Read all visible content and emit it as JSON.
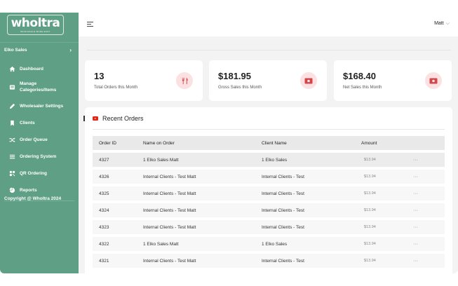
{
  "brand": {
    "name": "wholtra",
    "tagline": "WHOLESALE MADE EASY"
  },
  "sidebar": {
    "org": "Elko Sales",
    "items": [
      {
        "label": "Dashboard",
        "icon": "home-icon"
      },
      {
        "label": "Manage Categories/Items",
        "icon": "list-icon"
      },
      {
        "label": "Wholesaler Settings",
        "icon": "pencil-icon"
      },
      {
        "label": "Clients",
        "icon": "bookmark-icon"
      },
      {
        "label": "Order Queue",
        "icon": "shuffle-icon"
      },
      {
        "label": "Ordering System",
        "icon": "menu-lines-icon"
      },
      {
        "label": "QR Ordering",
        "icon": "qr-code-icon"
      },
      {
        "label": "Reports",
        "icon": "pie-chart-icon"
      }
    ],
    "copyright": "Copyright @ Wholtra 2024"
  },
  "header": {
    "user": "Matt"
  },
  "stats": [
    {
      "value": "13",
      "caption": "Total Orders this Month",
      "icon": "fork-knife-icon"
    },
    {
      "value": "$181.95",
      "caption": "Gross Sales this Month",
      "icon": "cash-icon"
    },
    {
      "value": "$168.40",
      "caption": "Net Sales this Month",
      "icon": "cash-icon"
    }
  ],
  "orders": {
    "title": "Recent Orders",
    "columns": [
      "Order ID",
      "Name on Order",
      "Client Name",
      "Amount"
    ],
    "rows": [
      [
        "4327",
        "1 Elko Sales Matt",
        "1 Elko Sales",
        "$13.94"
      ],
      [
        "4326",
        "Internal Clients - Test Matt",
        "Internal Clients - Test",
        "$13.94"
      ],
      [
        "4325",
        "Internal Clients - Test Matt",
        "Internal Clients - Test",
        "$13.94"
      ],
      [
        "4324",
        "Internal Clients - Test Matt",
        "Internal Clients - Test",
        "$13.94"
      ],
      [
        "4323",
        "Internal Clients - Test Matt",
        "Internal Clients - Test",
        "$13.94"
      ],
      [
        "4322",
        "1 Elko Sales Matt",
        "1 Elko Sales",
        "$13.94"
      ],
      [
        "4321",
        "Internal Clients - Test Matt",
        "Internal Clients - Test",
        "$13.94"
      ]
    ],
    "row_action": "···"
  },
  "colors": {
    "sidebar": "#5f9f86",
    "badge_bg": "#fbe1e2",
    "badge_icon": "#d2474c"
  }
}
